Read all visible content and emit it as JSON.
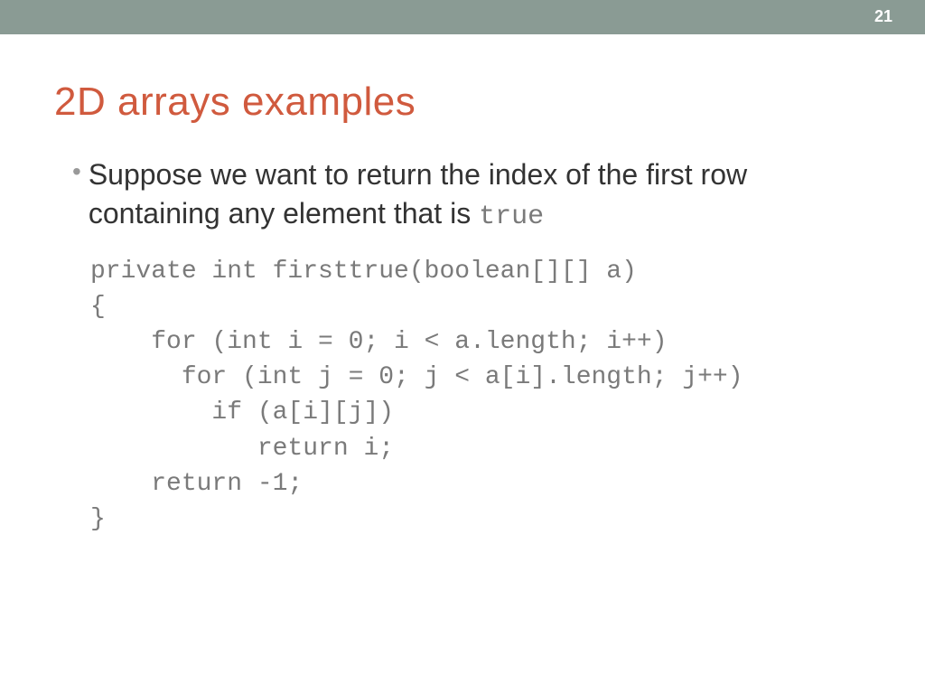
{
  "page_number": "21",
  "title": "2D arrays examples",
  "bullet": {
    "text_before": "Suppose we want to return the index of the first row containing any element that is ",
    "code_word": "true"
  },
  "code": "private int firsttrue(boolean[][] a)\n{\n    for (int i = 0; i < a.length; i++)\n      for (int j = 0; j < a[i].length; j++)\n        if (a[i][j])\n           return i;\n    return -1;\n}"
}
